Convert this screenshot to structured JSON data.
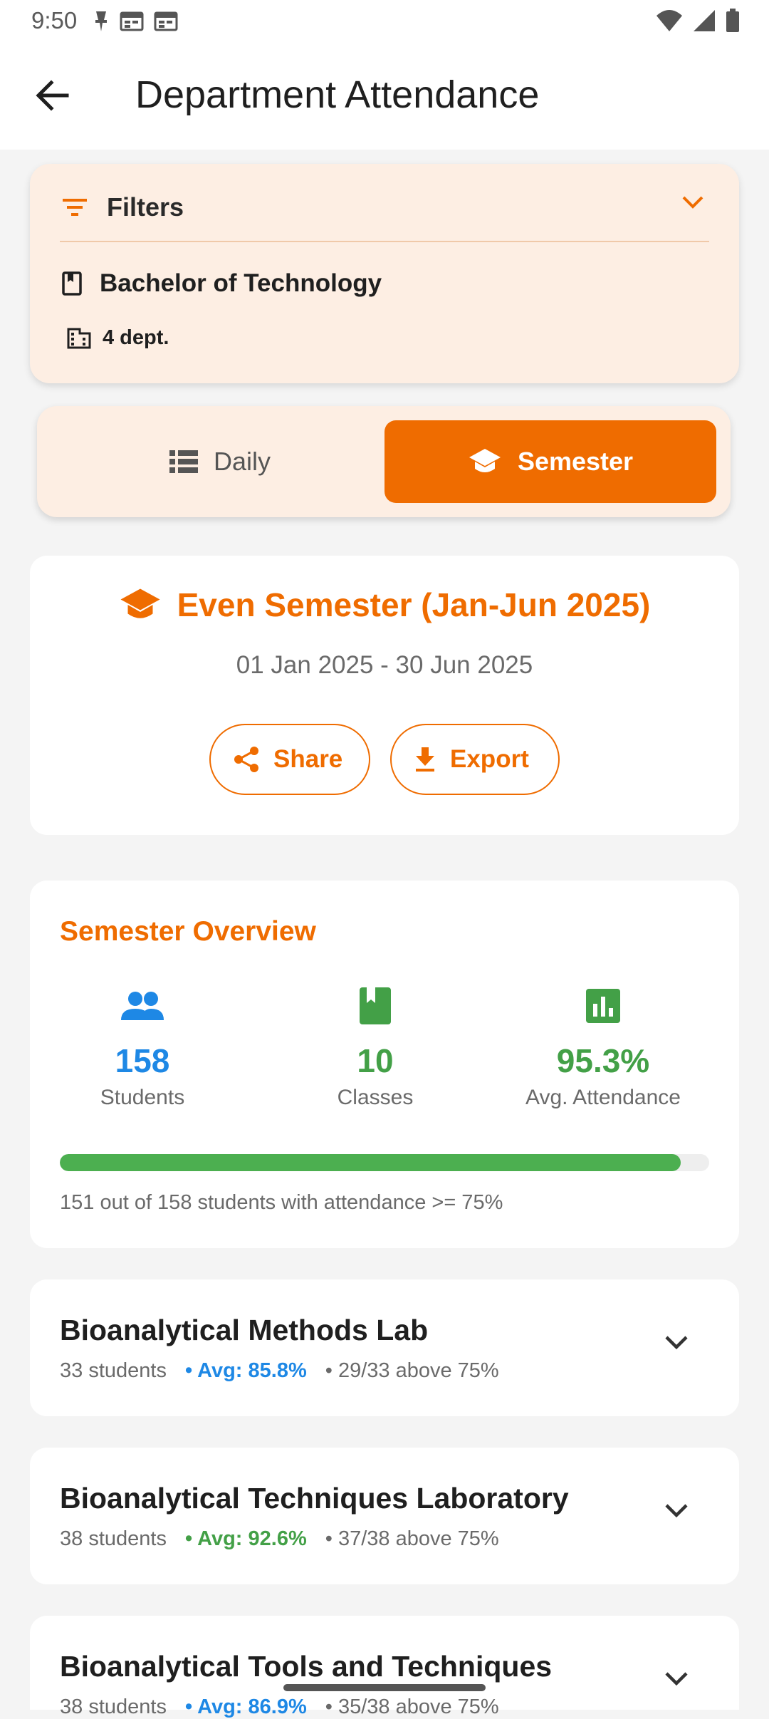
{
  "status_bar": {
    "time": "9:50"
  },
  "header": {
    "title": "Department Attendance"
  },
  "filters": {
    "label": "Filters",
    "program": "Bachelor of Technology",
    "departments": "4 dept."
  },
  "view_toggle": {
    "options": [
      {
        "label": "Daily",
        "selected": false
      },
      {
        "label": "Semester",
        "selected": true
      }
    ]
  },
  "semester": {
    "title": "Even Semester (Jan-Jun 2025)",
    "date_range": "01 Jan 2025 - 30 Jun 2025",
    "share_label": "Share",
    "export_label": "Export"
  },
  "overview": {
    "title": "Semester Overview",
    "stats": [
      {
        "value": "158",
        "label": "Students",
        "icon": "people-icon",
        "color": "#1e88e5"
      },
      {
        "value": "10",
        "label": "Classes",
        "icon": "book-icon",
        "color": "#43a047"
      },
      {
        "value": "95.3%",
        "label": "Avg. Attendance",
        "icon": "bar-chart-icon",
        "color": "#43a047"
      }
    ],
    "progress_fraction": 0.956,
    "note": "151 out of 158 students with attendance >= 75%"
  },
  "classes": [
    {
      "name": "Bioanalytical Methods Lab",
      "students": "33 students",
      "avg": "• Avg: 85.8%",
      "avg_color": "#1e88e5",
      "above": "• 29/33 above 75%"
    },
    {
      "name": "Bioanalytical Techniques Laboratory",
      "students": "38 students",
      "avg": "• Avg: 92.6%",
      "avg_color": "#43a047",
      "above": "• 37/38 above 75%"
    },
    {
      "name": "Bioanalytical Tools and Techniques",
      "students": "38 students",
      "avg": "• Avg: 86.9%",
      "avg_color": "#1e88e5",
      "above": "• 35/38 above 75%"
    }
  ],
  "colors": {
    "accent": "#ef6c00",
    "accent_light": "#fdeee3",
    "success": "#4caf50",
    "info": "#1e88e5"
  }
}
